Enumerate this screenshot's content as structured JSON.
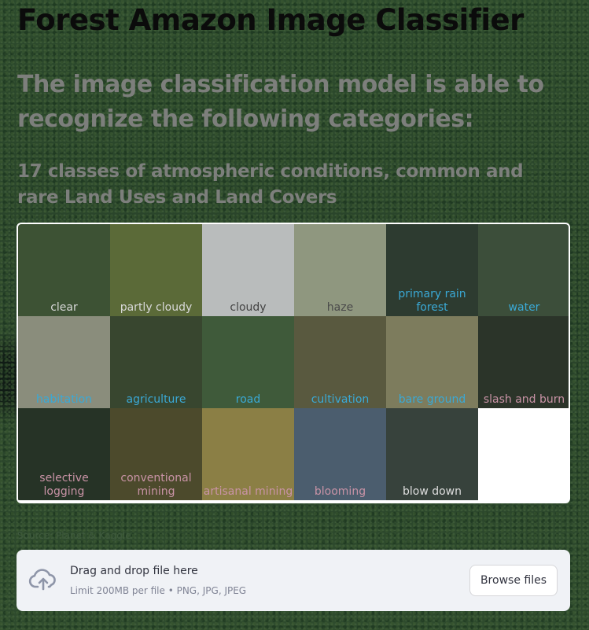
{
  "page": {
    "title": "Forest Amazon Image Classifier",
    "subtitle": "The image classification model is able to recognize the following categories:",
    "description": "17 classes of atmospheric conditions, common and rare Land Uses and Land Covers"
  },
  "grid": {
    "cells": [
      {
        "label": "clear",
        "bg": "#3d5234",
        "color": "#d8d8d8"
      },
      {
        "label": "partly cloudy",
        "bg": "#5b6a38",
        "color": "#d8d8d8"
      },
      {
        "label": "cloudy",
        "bg": "#b9bcbc",
        "color": "#444444"
      },
      {
        "label": "haze",
        "bg": "#8f977f",
        "color": "#4a4a4a"
      },
      {
        "label": "primary rain forest",
        "bg": "#2d3b30",
        "color": "#3aa9d6"
      },
      {
        "label": "water",
        "bg": "#3c4e3a",
        "color": "#3aa9d6"
      },
      {
        "label": "habitation",
        "bg": "#8a8d7c",
        "color": "#3aa9d6"
      },
      {
        "label": "agriculture",
        "bg": "#38462f",
        "color": "#3aa9d6"
      },
      {
        "label": "road",
        "bg": "#3f5a3a",
        "color": "#3aa9d6"
      },
      {
        "label": "cultivation",
        "bg": "#59593f",
        "color": "#3aa9d6"
      },
      {
        "label": "bare ground",
        "bg": "#7d7c5d",
        "color": "#3aa9d6"
      },
      {
        "label": "slash and burn",
        "bg": "#2b3429",
        "color": "#c993a6"
      },
      {
        "label": "selective logging",
        "bg": "#263326",
        "color": "#c993a6"
      },
      {
        "label": "conventional mining",
        "bg": "#4c4a2c",
        "color": "#c993a6"
      },
      {
        "label": "artisanal mining",
        "bg": "#8b7f45",
        "color": "#c993a6"
      },
      {
        "label": "blooming",
        "bg": "#4b5d6e",
        "color": "#c993a6"
      },
      {
        "label": "blow down",
        "bg": "#37423c",
        "color": "#dddddd"
      },
      {
        "label": "",
        "bg": "#ffffff",
        "color": "#ffffff"
      }
    ]
  },
  "caption": "Source: Planet & Kaggle",
  "uploader": {
    "drop_text": "Drag and drop file here",
    "limit_text": "Limit 200MB per file • PNG, JPG, JPEG",
    "browse_label": "Browse files",
    "icon": "cloud-upload-icon"
  }
}
